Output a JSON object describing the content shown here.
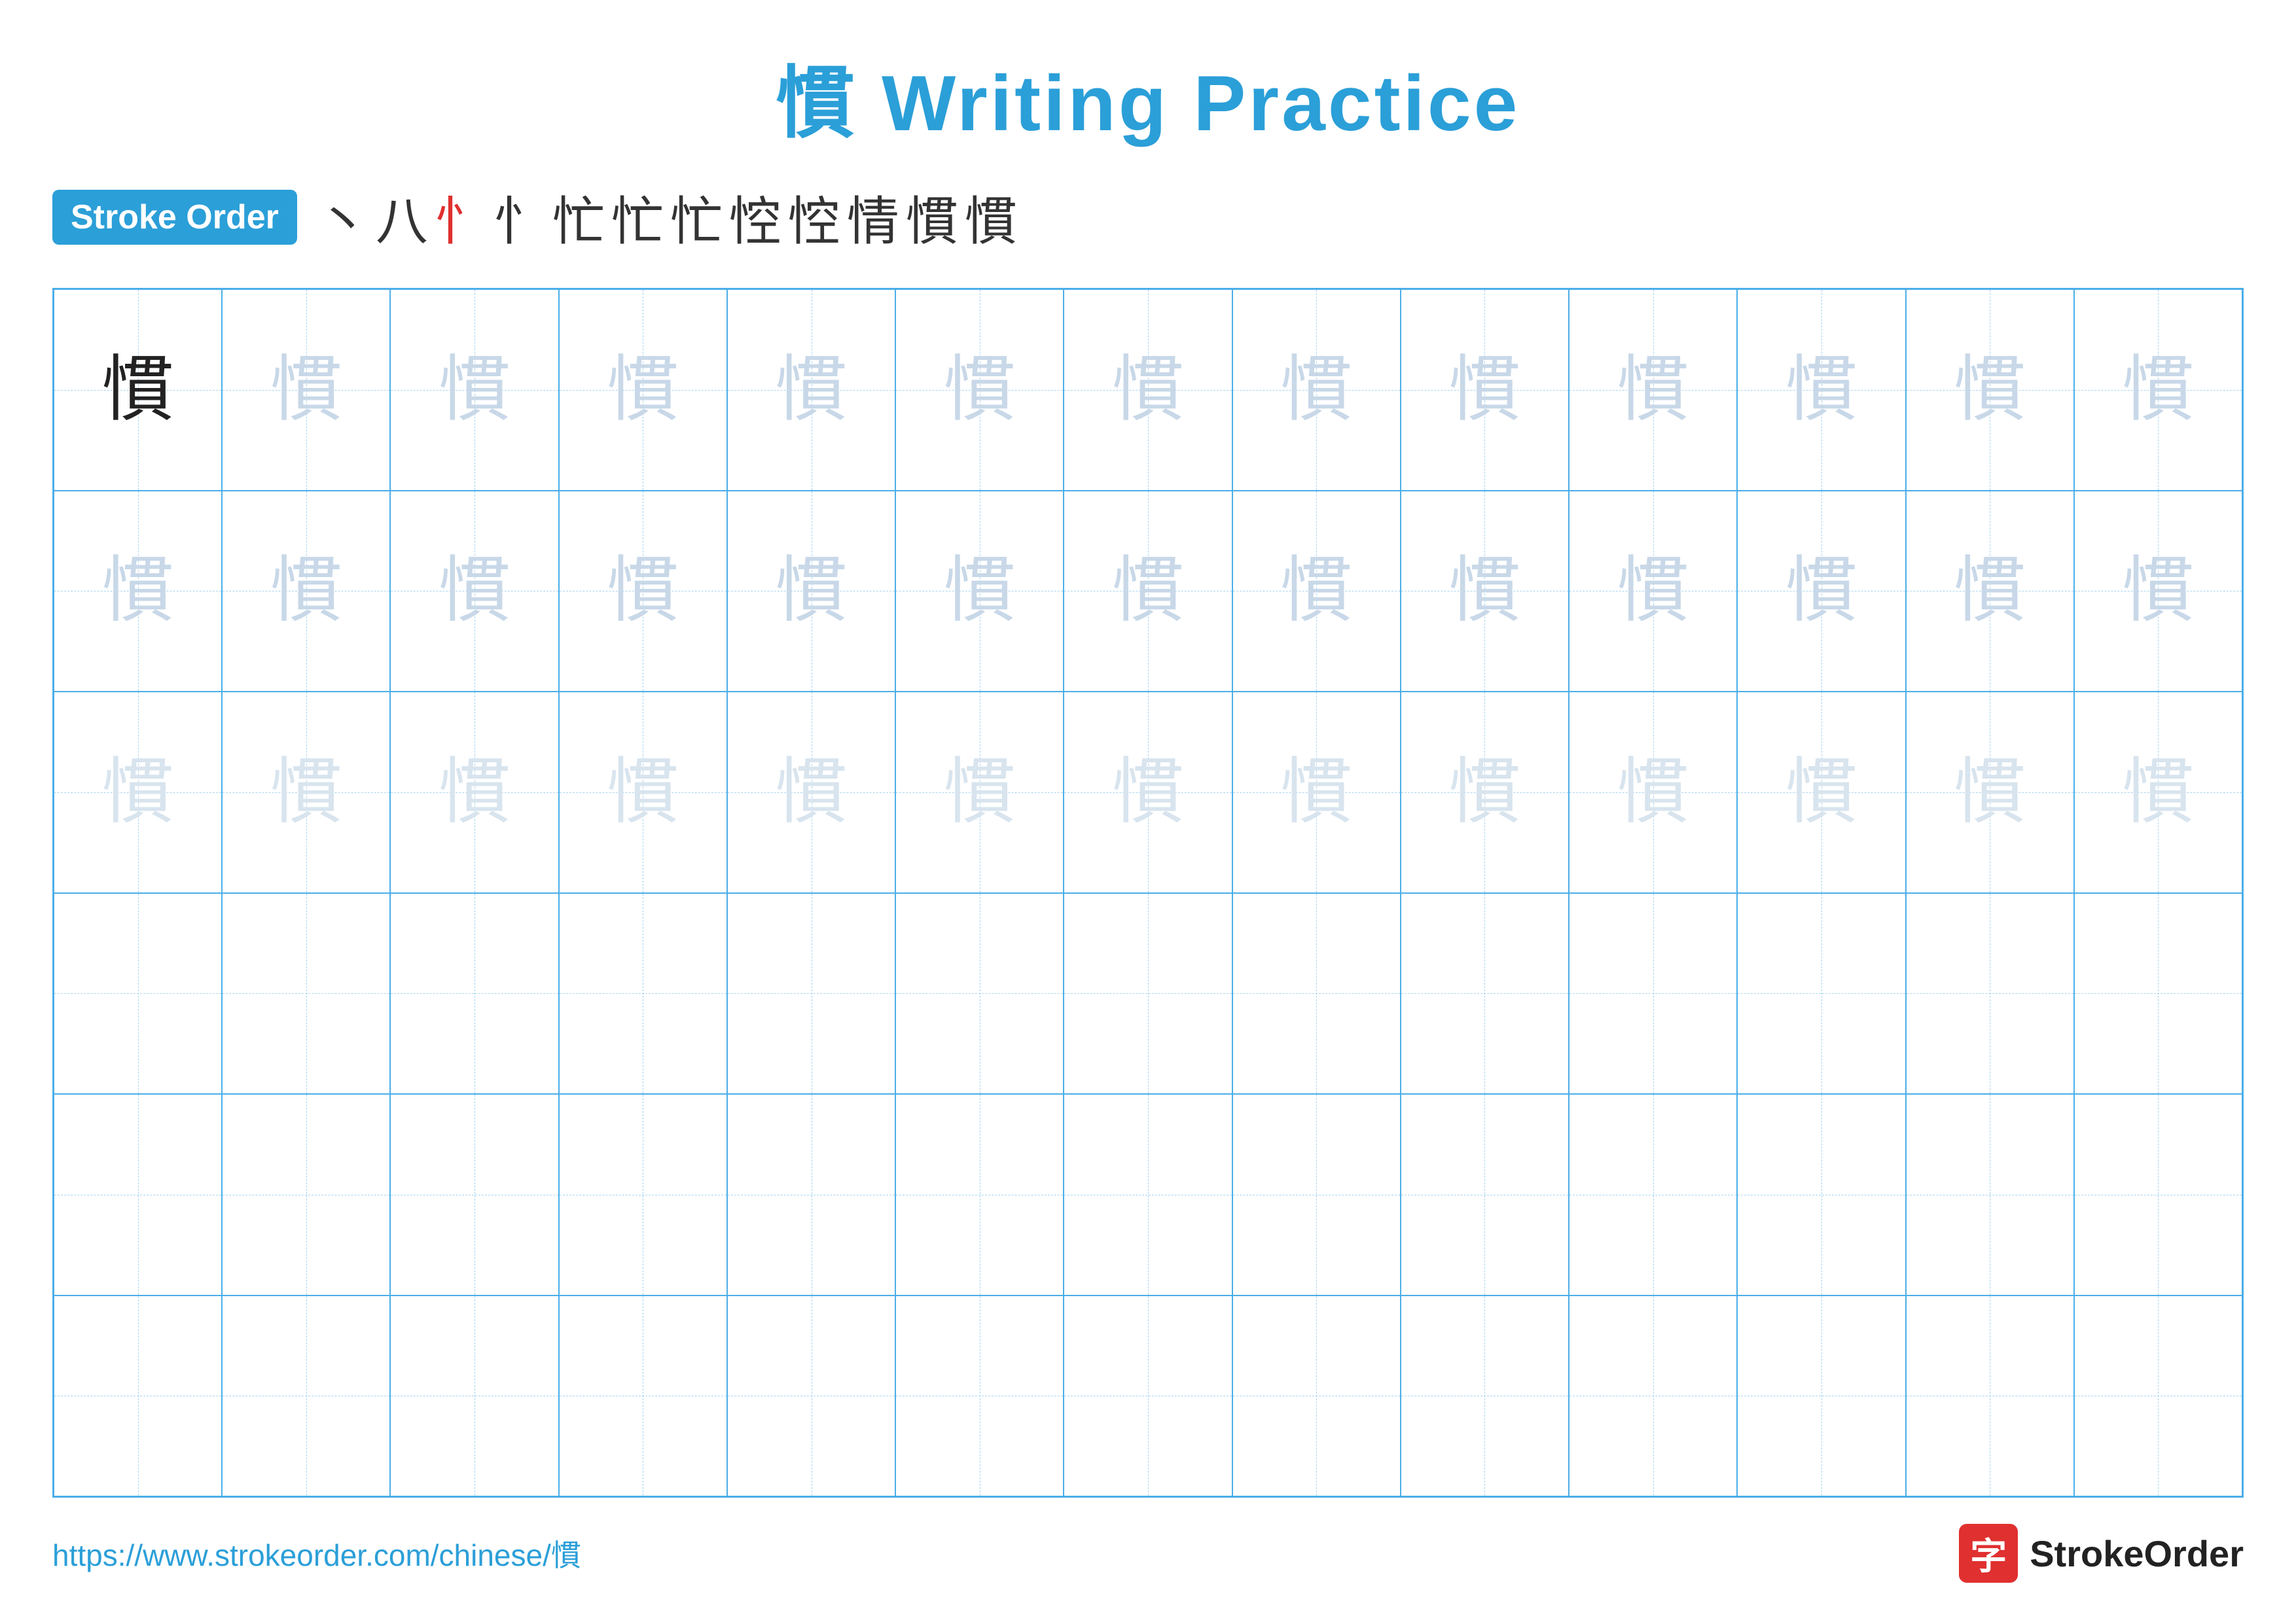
{
  "title": "慣 Writing Practice",
  "stroke_order_badge": "Stroke Order",
  "stroke_sequence": [
    "丶",
    "八",
    "忄",
    "忄",
    "忙",
    "忙",
    "忙",
    "悾",
    "悾",
    "情",
    "慣",
    "慣"
  ],
  "character": "慣",
  "rows": [
    {
      "cells": [
        {
          "type": "dark"
        },
        {
          "type": "light-1"
        },
        {
          "type": "light-1"
        },
        {
          "type": "light-1"
        },
        {
          "type": "light-1"
        },
        {
          "type": "light-1"
        },
        {
          "type": "light-1"
        },
        {
          "type": "light-1"
        },
        {
          "type": "light-1"
        },
        {
          "type": "light-1"
        },
        {
          "type": "light-1"
        },
        {
          "type": "light-1"
        },
        {
          "type": "light-1"
        }
      ]
    },
    {
      "cells": [
        {
          "type": "light-1"
        },
        {
          "type": "light-1"
        },
        {
          "type": "light-1"
        },
        {
          "type": "light-1"
        },
        {
          "type": "light-1"
        },
        {
          "type": "light-1"
        },
        {
          "type": "light-1"
        },
        {
          "type": "light-1"
        },
        {
          "type": "light-1"
        },
        {
          "type": "light-1"
        },
        {
          "type": "light-1"
        },
        {
          "type": "light-1"
        },
        {
          "type": "light-1"
        }
      ]
    },
    {
      "cells": [
        {
          "type": "light-2"
        },
        {
          "type": "light-2"
        },
        {
          "type": "light-2"
        },
        {
          "type": "light-2"
        },
        {
          "type": "light-2"
        },
        {
          "type": "light-2"
        },
        {
          "type": "light-2"
        },
        {
          "type": "light-2"
        },
        {
          "type": "light-2"
        },
        {
          "type": "light-2"
        },
        {
          "type": "light-2"
        },
        {
          "type": "light-2"
        },
        {
          "type": "light-2"
        }
      ]
    },
    {
      "cells": [
        {
          "type": "empty"
        },
        {
          "type": "empty"
        },
        {
          "type": "empty"
        },
        {
          "type": "empty"
        },
        {
          "type": "empty"
        },
        {
          "type": "empty"
        },
        {
          "type": "empty"
        },
        {
          "type": "empty"
        },
        {
          "type": "empty"
        },
        {
          "type": "empty"
        },
        {
          "type": "empty"
        },
        {
          "type": "empty"
        },
        {
          "type": "empty"
        }
      ]
    },
    {
      "cells": [
        {
          "type": "empty"
        },
        {
          "type": "empty"
        },
        {
          "type": "empty"
        },
        {
          "type": "empty"
        },
        {
          "type": "empty"
        },
        {
          "type": "empty"
        },
        {
          "type": "empty"
        },
        {
          "type": "empty"
        },
        {
          "type": "empty"
        },
        {
          "type": "empty"
        },
        {
          "type": "empty"
        },
        {
          "type": "empty"
        },
        {
          "type": "empty"
        }
      ]
    },
    {
      "cells": [
        {
          "type": "empty"
        },
        {
          "type": "empty"
        },
        {
          "type": "empty"
        },
        {
          "type": "empty"
        },
        {
          "type": "empty"
        },
        {
          "type": "empty"
        },
        {
          "type": "empty"
        },
        {
          "type": "empty"
        },
        {
          "type": "empty"
        },
        {
          "type": "empty"
        },
        {
          "type": "empty"
        },
        {
          "type": "empty"
        },
        {
          "type": "empty"
        }
      ]
    }
  ],
  "footer": {
    "url": "https://www.strokeorder.com/chinese/慣",
    "logo_char": "字",
    "logo_text": "StrokeOrder"
  }
}
